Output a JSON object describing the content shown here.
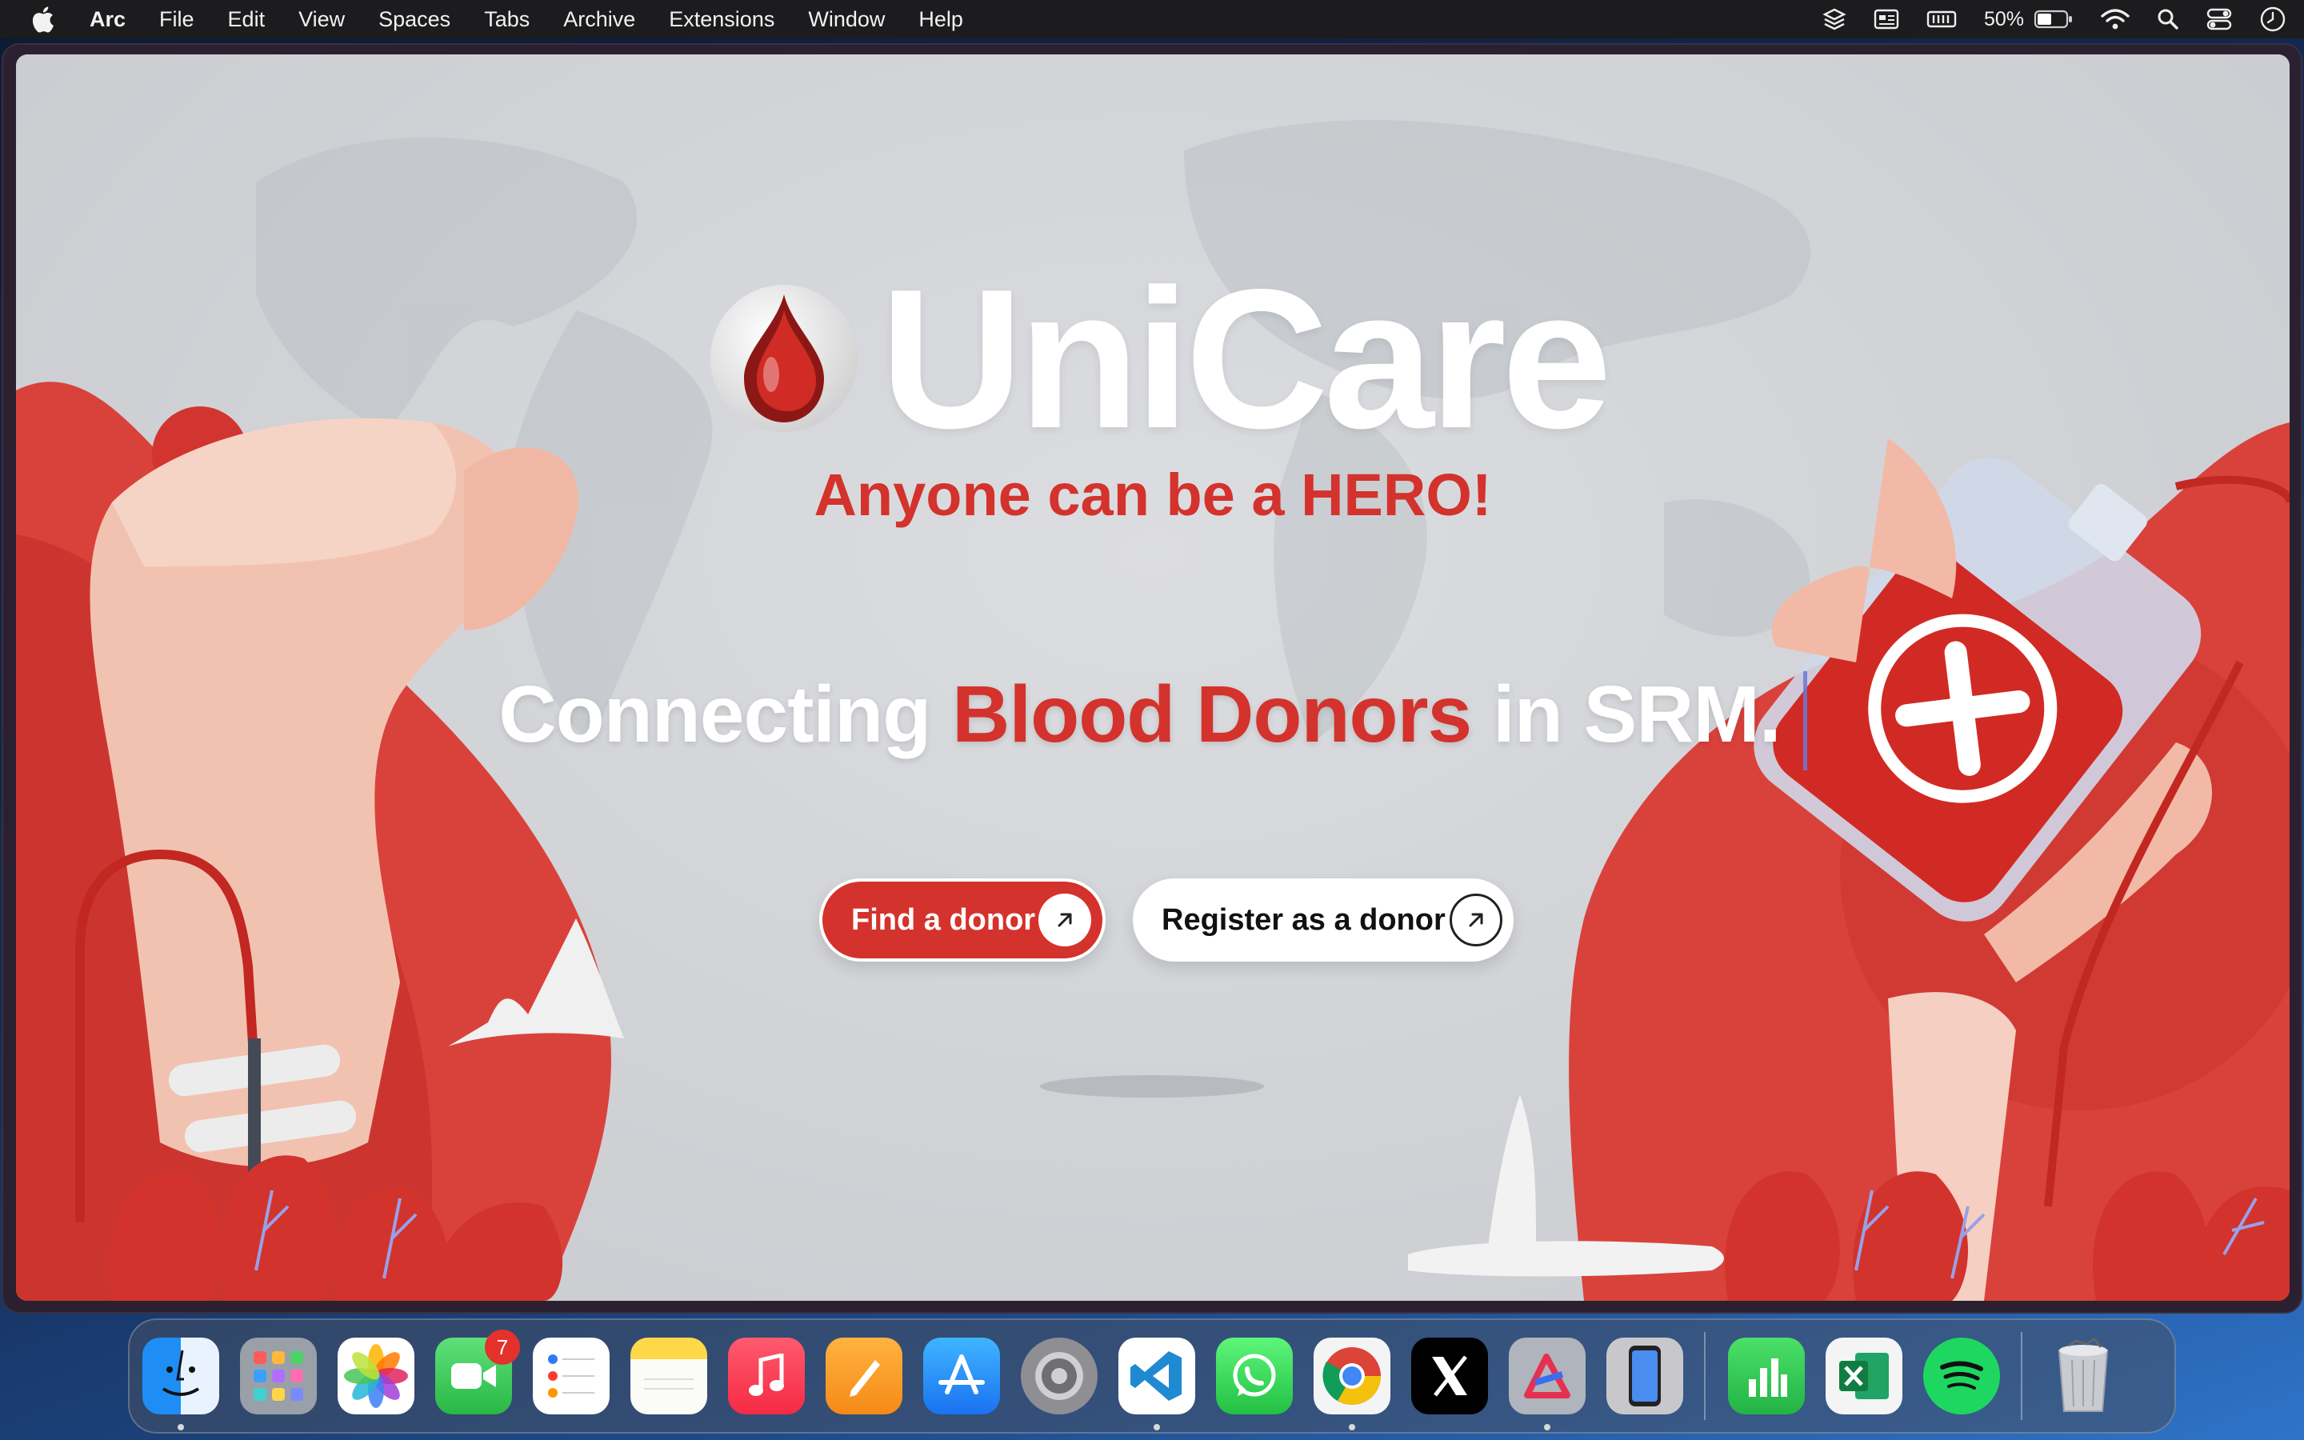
{
  "menubar": {
    "app_name": "Arc",
    "menus": [
      "File",
      "Edit",
      "View",
      "Spaces",
      "Tabs",
      "Archive",
      "Extensions",
      "Window",
      "Help"
    ],
    "battery_percent": "50%",
    "status_icons": [
      "layers-icon",
      "news-icon",
      "memory-icon",
      "battery-icon",
      "wifi-icon",
      "search-icon",
      "control-center-icon",
      "clock-icon"
    ]
  },
  "hero": {
    "brand": "UniCare",
    "tagline": "Anyone can be a HERO!",
    "headline_part1": "Connecting ",
    "headline_accent": "Blood Donors",
    "headline_part2": " in SRM.",
    "find_button": "Find a donor",
    "register_button": "Register as a donor"
  },
  "colors": {
    "brand_red": "#d4322c",
    "hero_white": "#ffffff"
  },
  "dock": {
    "apps": [
      "finder",
      "launchpad",
      "photos",
      "facetime",
      "reminders",
      "notes",
      "music",
      "pages",
      "app-store",
      "system-settings",
      "vscode",
      "whatsapp",
      "chrome",
      "x",
      "affinity",
      "iphone-mirroring",
      "numbers",
      "excel",
      "spotify",
      "trash"
    ],
    "facetime_badge": "7"
  }
}
